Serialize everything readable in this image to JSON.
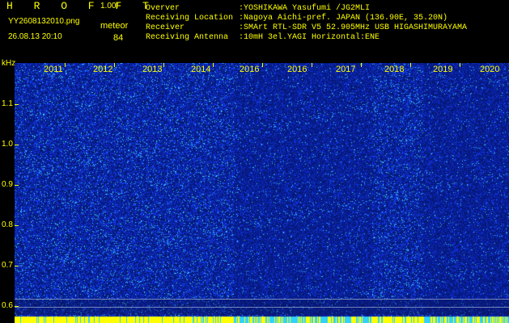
{
  "header": {
    "app_name": "H R O F F T",
    "version": "1.00f",
    "filename": "YY2608132010.png",
    "datetime": "26.08.13 20:10",
    "meteor_label": "meteor",
    "meteor_count": "84"
  },
  "info": [
    {
      "key": "Overver",
      "value": ":YOSHIKAWA Yasufumi /JG2MLI"
    },
    {
      "key": "Receiving Location",
      "value": ":Nagoya Aichi-pref. JAPAN (136.90E, 35.20N)"
    },
    {
      "key": "Receiver",
      "value": ":SMArt RTL-SDR V5 52.905MHz USB HIGASHIMURAYAMA"
    },
    {
      "key": "Receiving Antenna",
      "value": ":10mH 3el.YAGI Horizontal:ENE"
    }
  ],
  "plot": {
    "y_unit": "kHz",
    "y_ticks": [
      "1.1",
      "1.0",
      "0.9",
      "0.8",
      "0.7",
      "0.6"
    ],
    "x_ticks": [
      "2011",
      "2012",
      "2013",
      "2014",
      "2016",
      "2016",
      "2017",
      "2018",
      "2019",
      "2020"
    ],
    "colors": {
      "background": "#000000",
      "text": "#ffff00",
      "waterfall_dark": "#06186e",
      "waterfall_bright": "#2a56ff",
      "speck": "#39c8ff",
      "bottom_bar": "#ffff00"
    }
  }
}
